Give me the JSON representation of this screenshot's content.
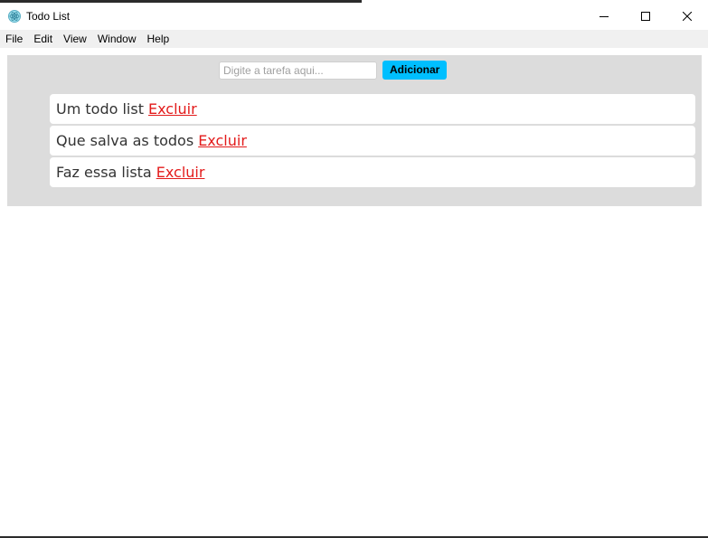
{
  "window": {
    "title": "Todo List",
    "controls": [
      "minimize-icon",
      "maximize-icon",
      "close-icon"
    ]
  },
  "menu": {
    "items": [
      "File",
      "Edit",
      "View",
      "Window",
      "Help"
    ]
  },
  "form": {
    "placeholder": "Digite a tarefa aqui...",
    "value": "",
    "add_label": "Adicionar"
  },
  "todos": [
    {
      "text": "Um todo list",
      "delete_label": "Excluir"
    },
    {
      "text": "Que salva as todos",
      "delete_label": "Excluir"
    },
    {
      "text": "Faz essa lista",
      "delete_label": "Excluir"
    }
  ],
  "colors": {
    "panel": "#dcdcdc",
    "accent_button": "#00bfff",
    "delete_link": "#e31b1b"
  }
}
